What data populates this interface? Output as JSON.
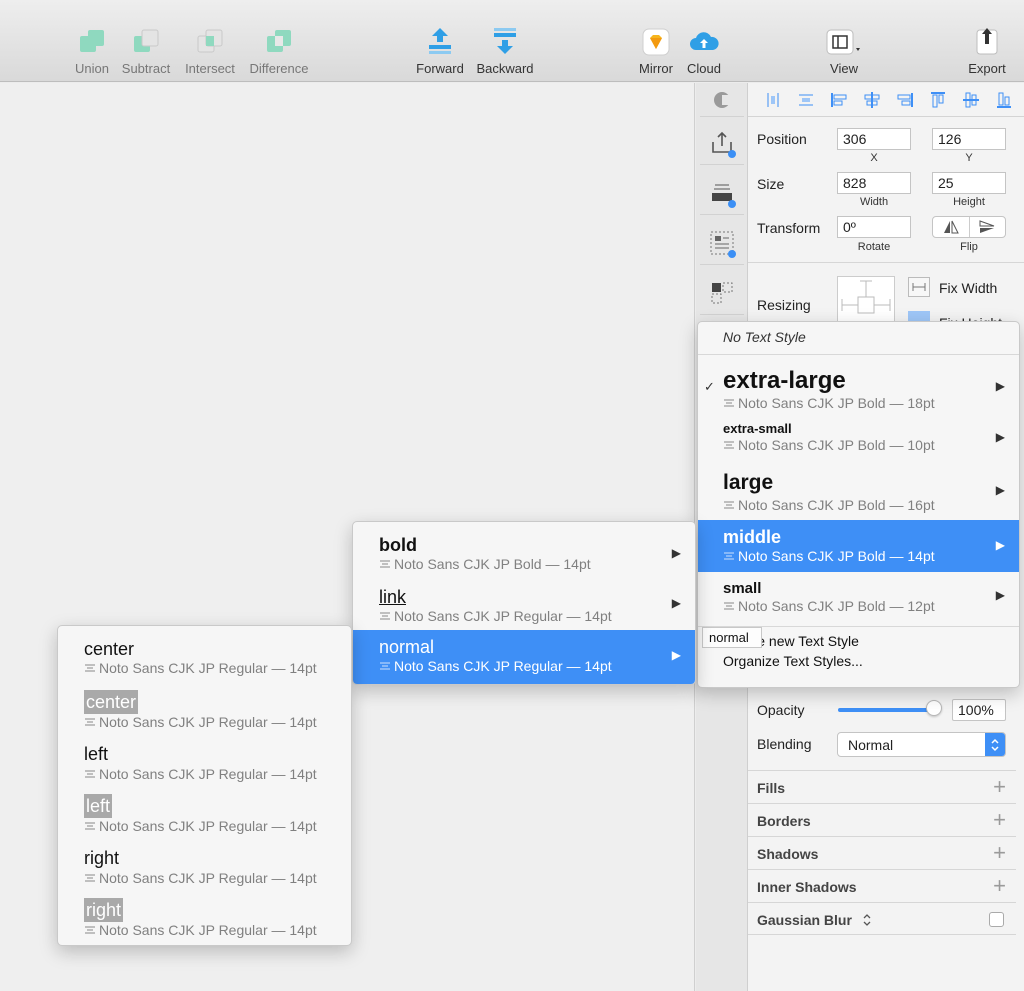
{
  "toolbar": {
    "union": "Union",
    "subtract": "Subtract",
    "intersect": "Intersect",
    "difference": "Difference",
    "forward": "Forward",
    "backward": "Backward",
    "mirror": "Mirror",
    "cloud": "Cloud",
    "view": "View",
    "export": "Export"
  },
  "inspector": {
    "position_label": "Position",
    "x_value": "306",
    "x_label": "X",
    "y_value": "126",
    "y_label": "Y",
    "size_label": "Size",
    "width_value": "828",
    "width_label": "Width",
    "height_value": "25",
    "height_label": "Height",
    "transform_label": "Transform",
    "rotate_value": "0º",
    "rotate_label": "Rotate",
    "flip_label": "Flip",
    "resizing_label": "Resizing",
    "fix_width": "Fix Width",
    "fix_height": "Fix Height",
    "opacity_label": "Opacity",
    "opacity_value": "100%",
    "opacity_fraction": 1.0,
    "blending_label": "Blending",
    "blending_value": "Normal",
    "sections": {
      "fills": "Fills",
      "borders": "Borders",
      "shadows": "Shadows",
      "inner_shadows": "Inner Shadows",
      "gaussian_blur": "Gaussian Blur"
    }
  },
  "text_style_menu": {
    "no_style": "No Text Style",
    "items": [
      {
        "name": "extra-large",
        "meta": "Noto Sans CJK JP Bold — 18pt"
      },
      {
        "name": "extra-small",
        "meta": "Noto Sans CJK JP Bold — 10pt"
      },
      {
        "name": "large",
        "meta": "Noto Sans CJK JP Bold — 16pt"
      },
      {
        "name": "middle",
        "meta": "Noto Sans CJK JP Bold — 14pt"
      },
      {
        "name": "small",
        "meta": "Noto Sans CJK JP Bold — 12pt"
      }
    ],
    "create": "Create new Text Style",
    "organize": "Organize Text Styles..."
  },
  "middle_submenu": {
    "items": [
      {
        "name": "bold",
        "meta": "Noto Sans CJK JP Bold — 14pt"
      },
      {
        "name": "link",
        "meta": "Noto Sans CJK JP Regular — 14pt"
      },
      {
        "name": "normal",
        "meta": "Noto Sans CJK JP Regular — 14pt"
      }
    ]
  },
  "normal_submenu": {
    "items": [
      {
        "name": "center",
        "meta": "Noto Sans CJK JP Regular — 14pt"
      },
      {
        "name": "center",
        "meta": "Noto Sans CJK JP Regular — 14pt"
      },
      {
        "name": "left",
        "meta": "Noto Sans CJK JP Regular — 14pt"
      },
      {
        "name": "left",
        "meta": "Noto Sans CJK JP Regular — 14pt"
      },
      {
        "name": "right",
        "meta": "Noto Sans CJK JP Regular — 14pt"
      },
      {
        "name": "right",
        "meta": "Noto Sans CJK JP Regular — 14pt"
      }
    ]
  },
  "tooltip": "normal",
  "colors": {
    "accent": "#3e8ff6",
    "bool_icon": "#7dd3b6"
  }
}
